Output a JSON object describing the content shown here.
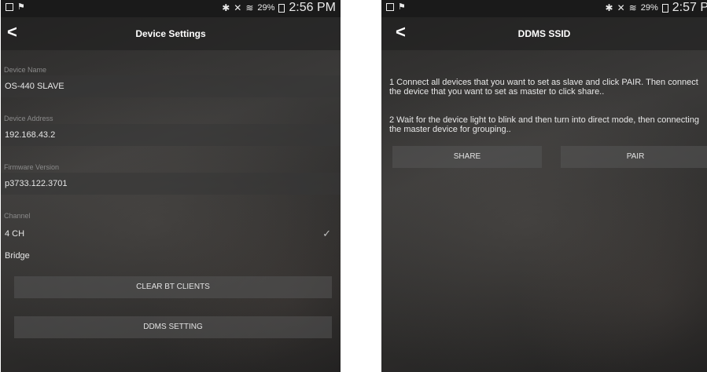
{
  "left": {
    "status": {
      "battery": "29%",
      "time": "2:56 PM"
    },
    "header": {
      "back": "<",
      "title": "Device Settings"
    },
    "device_name": {
      "label": "Device Name",
      "value": "OS-440 SLAVE"
    },
    "device_address": {
      "label": "Device Address",
      "value": "192.168.43.2"
    },
    "firmware_version": {
      "label": "Firmware Version",
      "value": "p3733.122.3701"
    },
    "channel": {
      "label": "Channel",
      "options": [
        {
          "label": "4 CH",
          "selected": true
        },
        {
          "label": "Bridge",
          "selected": false
        }
      ],
      "check": "✓"
    },
    "buttons": {
      "clear": "CLEAR BT CLIENTS",
      "ddms": "DDMS SETTING"
    }
  },
  "right": {
    "status": {
      "battery": "29%",
      "time": "2:57 P"
    },
    "header": {
      "back": "<",
      "title": "DDMS SSID"
    },
    "instructions": [
      {
        "line1": "1 Connect all devices that you want to set as slave and click PAIR. Then connect",
        "line2": "the device that you want to set as master to click share.."
      },
      {
        "line1": "2 Wait for the device light to blink and then turn into direct mode, then connecting",
        "line2": "the master device for grouping.."
      }
    ],
    "buttons": {
      "share": "SHARE",
      "pair": "PAIR"
    }
  }
}
